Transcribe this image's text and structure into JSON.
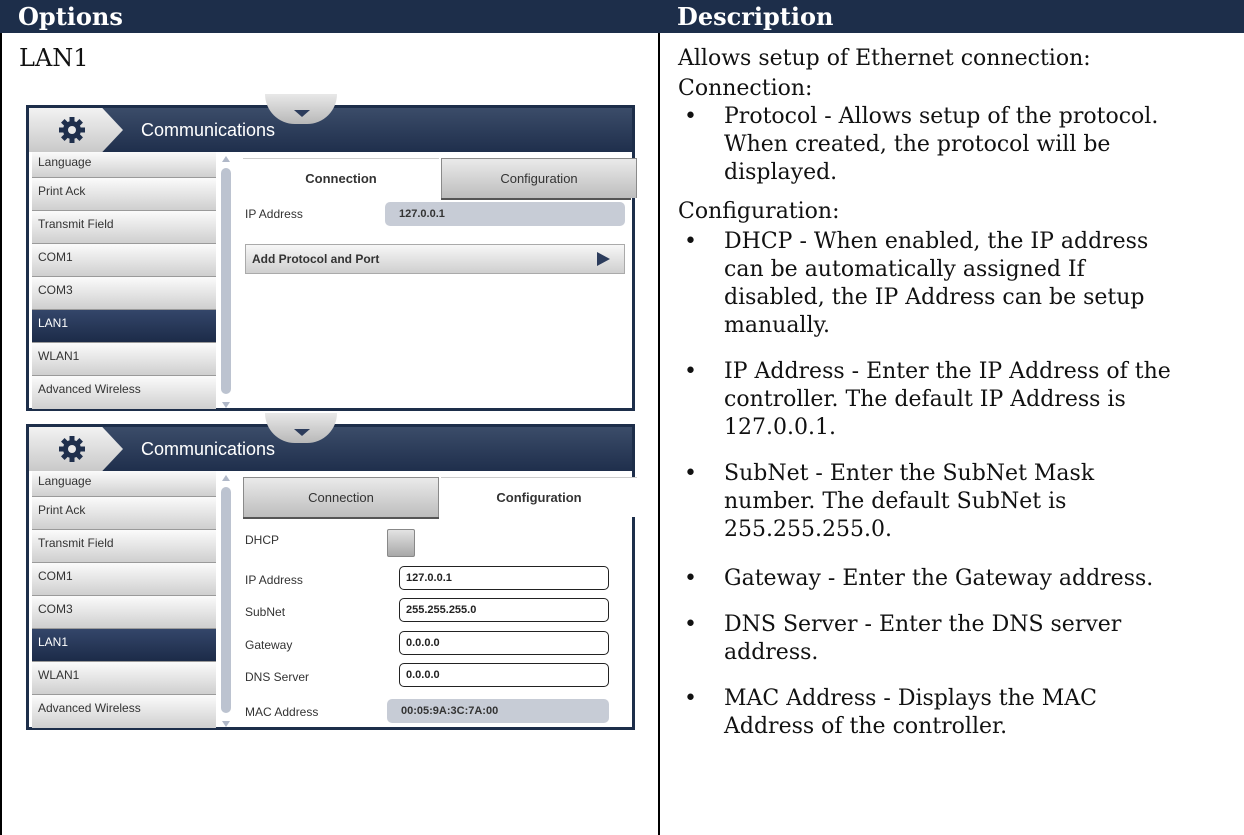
{
  "table": {
    "headers": {
      "options": "Options",
      "description": "Description"
    },
    "option_name": "LAN1"
  },
  "screen1": {
    "title": "Communications",
    "sidebar_items": [
      "Language",
      "Print Ack",
      "Transmit Field",
      "COM1",
      "COM3",
      "LAN1",
      "WLAN1",
      "Advanced Wireless"
    ],
    "active_item": "LAN1",
    "tabs": {
      "connection": "Connection",
      "configuration": "Configuration"
    },
    "selected_tab": "Connection",
    "ip_label": "IP Address",
    "ip_value": "127.0.0.1",
    "add_protocol": "Add Protocol and Port"
  },
  "screen2": {
    "title": "Communications",
    "sidebar_items": [
      "Language",
      "Print Ack",
      "Transmit Field",
      "COM1",
      "COM3",
      "LAN1",
      "WLAN1",
      "Advanced Wireless"
    ],
    "active_item": "LAN1",
    "tabs": {
      "connection": "Connection",
      "configuration": "Configuration"
    },
    "selected_tab": "Configuration",
    "fields": {
      "dhcp": {
        "label": "DHCP",
        "checked": false
      },
      "ip": {
        "label": "IP Address",
        "value": "127.0.0.1"
      },
      "subnet": {
        "label": "SubNet",
        "value": "255.255.255.0"
      },
      "gateway": {
        "label": "Gateway",
        "value": "0.0.0.0"
      },
      "dns": {
        "label": "DNS Server",
        "value": "0.0.0.0"
      },
      "mac": {
        "label": "MAC Address",
        "value": "00:05:9A:3C:7A:00"
      }
    }
  },
  "description": {
    "intro": "Allows setup of Ethernet connection:",
    "connection_heading": "Connection:",
    "protocol": [
      "Protocol - Allows setup of the protocol.",
      "When created, the protocol will be",
      "displayed."
    ],
    "configuration_heading": "Configuration:",
    "dhcp": [
      "DHCP - When enabled, the IP address",
      "can be automatically assigned If",
      "disabled, the IP Address can be setup",
      "manually."
    ],
    "ip": [
      "IP Address - Enter the IP Address of the",
      "controller. The default IP Address is",
      "127.0.0.1."
    ],
    "subnet": [
      "SubNet - Enter the SubNet Mask",
      "number. The default SubNet is",
      "255.255.255.0."
    ],
    "gateway": [
      "Gateway - Enter the Gateway address."
    ],
    "dns": [
      "DNS Server - Enter the DNS server",
      "address."
    ],
    "mac": [
      "MAC Address - Displays the MAC",
      "Address of the controller."
    ]
  },
  "colors": {
    "header_bg": "#1d2e4a",
    "panel_titlebar": "#1f2f4c",
    "active_item": "#1c2b48"
  },
  "icons": {
    "settings": "gear-icon",
    "dropdown": "chevron-down-icon",
    "arrow": "play-arrow-icon"
  }
}
